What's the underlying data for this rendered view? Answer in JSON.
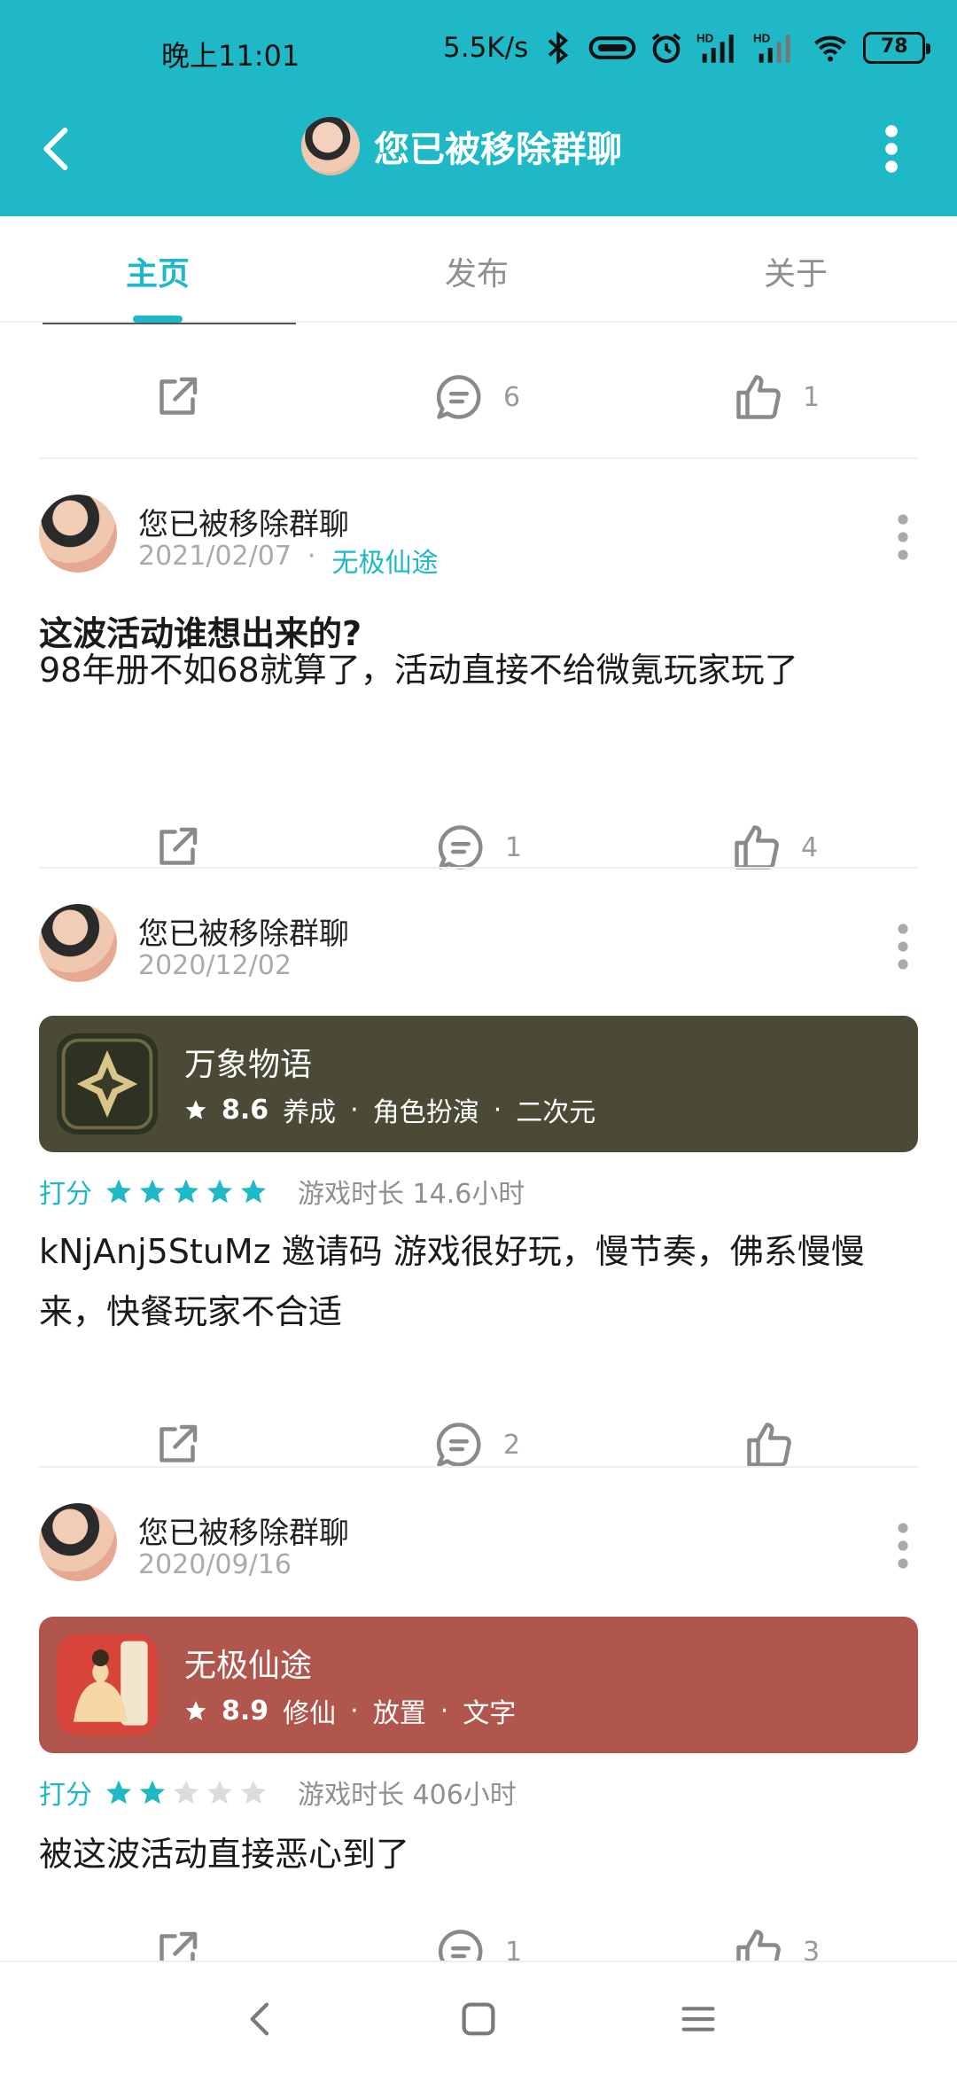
{
  "status_bar": {
    "time": "晚上11:01",
    "network_speed": "5.5K/s",
    "battery": "78",
    "icons": [
      "bluetooth-icon",
      "pill-icon",
      "alarm-icon",
      "hd-signal-icon",
      "hd-signal-icon",
      "wifi-icon",
      "battery-icon"
    ]
  },
  "header": {
    "title": "您已被移除群聊",
    "back_icon": "chevron-left-icon",
    "more_icon": "more-vertical-icon"
  },
  "tabs": [
    {
      "label": "主页",
      "active": true
    },
    {
      "label": "发布",
      "active": false
    },
    {
      "label": "关于",
      "active": false
    }
  ],
  "colors": {
    "accent": "#1fb8c6",
    "card_1": "#4a4a36",
    "card_2": "#b0564c"
  },
  "top_actions": {
    "comments": "6",
    "likes": "1"
  },
  "posts": [
    {
      "author": "您已被移除群聊",
      "date": "2021/02/07",
      "game": "无极仙途",
      "title": "这波活动谁想出来的?",
      "body": "98年册不如68就算了，活动直接不给微氪玩家玩了",
      "comments": "1",
      "likes": "4"
    },
    {
      "author": "您已被移除群聊",
      "date": "2020/12/02",
      "card": {
        "name": "万象物语",
        "score": "8.6",
        "tags": [
          "养成",
          "角色扮演",
          "二次元"
        ]
      },
      "rating_label": "打分",
      "stars": 5,
      "duration": "游戏时长 14.6小时",
      "body": "kNjAnj5StuMz 邀请码 游戏很好玩，慢节奏，佛系慢慢来，快餐玩家不合适",
      "comments": "2",
      "likes": ""
    },
    {
      "author": "您已被移除群聊",
      "date": "2020/09/16",
      "card": {
        "name": "无极仙途",
        "score": "8.9",
        "tags": [
          "修仙",
          "放置",
          "文字"
        ]
      },
      "rating_label": "打分",
      "stars": 2,
      "duration": "游戏时长 406小时",
      "body": "被这波活动直接恶心到了",
      "comments": "1",
      "likes": "3"
    }
  ],
  "navbar": {
    "icons": [
      "back-icon",
      "home-icon",
      "menu-icon"
    ]
  }
}
